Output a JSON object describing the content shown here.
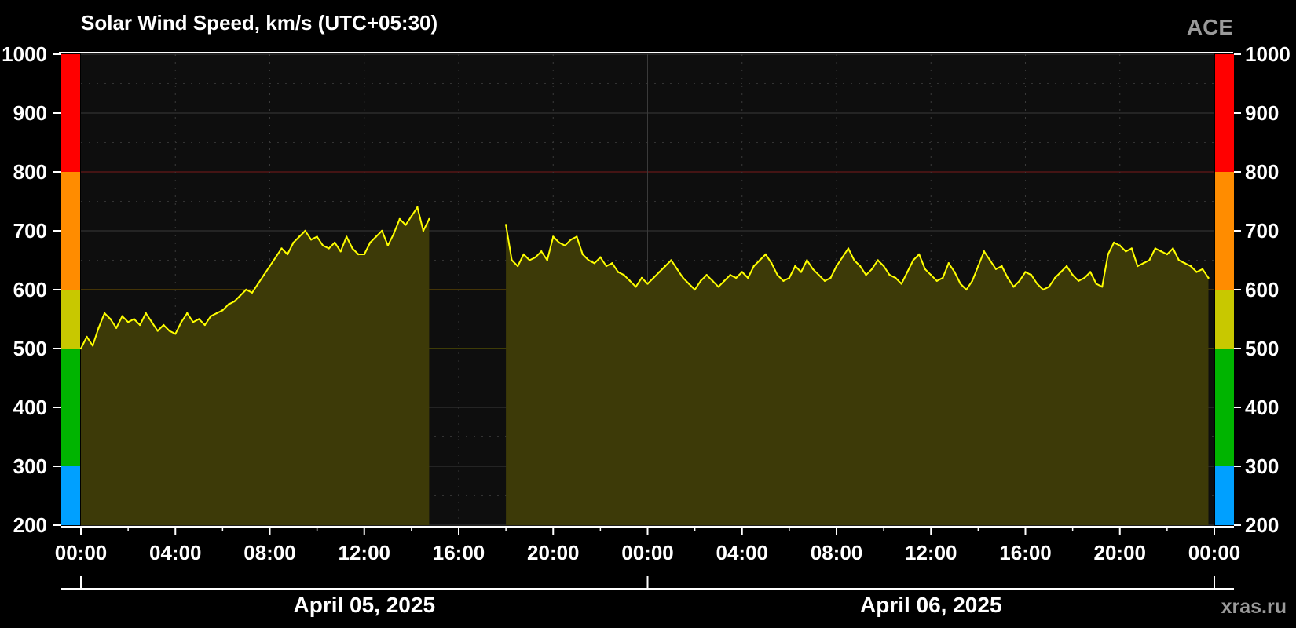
{
  "chart_data": {
    "type": "area",
    "title": "Solar Wind Speed, km/s (UTC+05:30)",
    "source_label": "ACE",
    "watermark": "xras.ru",
    "ylim": [
      200,
      1000
    ],
    "y_ticks": [
      "200",
      "300",
      "400",
      "500",
      "600",
      "700",
      "800",
      "900",
      "1000"
    ],
    "xlim_hours": [
      0,
      48
    ],
    "x_tick_labels": [
      "00:00",
      "04:00",
      "08:00",
      "12:00",
      "16:00",
      "20:00",
      "00:00",
      "04:00",
      "08:00",
      "12:00",
      "16:00",
      "20:00",
      "00:00"
    ],
    "dates": [
      "April 05, 2025",
      "April 06, 2025"
    ],
    "grid": true,
    "colors": {
      "line": "#ffff00",
      "fill": "#3d3a08",
      "plot_bg": "#0e0e0e",
      "band_quiet": "#00a0ff",
      "band_normal": "#00b400",
      "band_elevated": "#c8c800",
      "band_high": "#ff8c00",
      "band_extreme": "#ff0000"
    },
    "speed_bands": [
      {
        "from": 200,
        "to": 300,
        "color": "#00a0ff"
      },
      {
        "from": 300,
        "to": 500,
        "color": "#00b400"
      },
      {
        "from": 500,
        "to": 600,
        "color": "#c8c800"
      },
      {
        "from": 600,
        "to": 800,
        "color": "#ff8c00"
      },
      {
        "from": 800,
        "to": 1000,
        "color": "#ff0000"
      }
    ],
    "series": [
      {
        "x": [
          0.0,
          0.25,
          0.5,
          0.75,
          1.0,
          1.25,
          1.5,
          1.75,
          2.0,
          2.25,
          2.5,
          2.75,
          3.0,
          3.25,
          3.5,
          3.75,
          4.0,
          4.25,
          4.5,
          4.75,
          5.0,
          5.25,
          5.5,
          5.75,
          6.0,
          6.25,
          6.5,
          6.75,
          7.0,
          7.25,
          7.5,
          7.75,
          8.0,
          8.25,
          8.5,
          8.75,
          9.0,
          9.25,
          9.5,
          9.75,
          10.0,
          10.25,
          10.5,
          10.75,
          11.0,
          11.25,
          11.5,
          11.75,
          12.0,
          12.25,
          12.5,
          12.75,
          13.0,
          13.25,
          13.5,
          13.75,
          14.0,
          14.25,
          14.5,
          14.75
        ],
        "values": [
          500,
          520,
          505,
          535,
          560,
          550,
          535,
          555,
          545,
          550,
          540,
          560,
          545,
          530,
          540,
          530,
          525,
          545,
          560,
          545,
          550,
          540,
          555,
          560,
          565,
          575,
          580,
          590,
          600,
          595,
          610,
          625,
          640,
          655,
          670,
          660,
          680,
          690,
          700,
          685,
          690,
          675,
          670,
          680,
          665,
          690,
          670,
          660,
          660,
          680,
          690,
          700,
          675,
          695,
          720,
          710,
          725,
          740,
          700,
          720
        ]
      },
      {
        "x": [
          18.0,
          18.25,
          18.5,
          18.75,
          19.0,
          19.25,
          19.5,
          19.75,
          20.0,
          20.25,
          20.5,
          20.75,
          21.0,
          21.25,
          21.5,
          21.75,
          22.0,
          22.25,
          22.5,
          22.75,
          23.0,
          23.25,
          23.5,
          23.75,
          24.0,
          24.25,
          24.5,
          24.75,
          25.0,
          25.25,
          25.5,
          25.75,
          26.0,
          26.25,
          26.5,
          26.75,
          27.0,
          27.25,
          27.5,
          27.75,
          28.0,
          28.25,
          28.5,
          28.75,
          29.0,
          29.25,
          29.5,
          29.75,
          30.0,
          30.25,
          30.5,
          30.75,
          31.0,
          31.25,
          31.5,
          31.75,
          32.0,
          32.25,
          32.5,
          32.75,
          33.0,
          33.25,
          33.5,
          33.75,
          34.0,
          34.25,
          34.5,
          34.75,
          35.0,
          35.25,
          35.5,
          35.75,
          36.0,
          36.25,
          36.5,
          36.75,
          37.0,
          37.25,
          37.5,
          37.75,
          38.0,
          38.25,
          38.5,
          38.75,
          39.0,
          39.25,
          39.5,
          39.75,
          40.0,
          40.25,
          40.5,
          40.75,
          41.0,
          41.25,
          41.5,
          41.75,
          42.0,
          42.25,
          42.5,
          42.75,
          43.0,
          43.25,
          43.5,
          43.75,
          44.0,
          44.25,
          44.5,
          44.75,
          45.0,
          45.25,
          45.5,
          45.75,
          46.0,
          46.25,
          46.5,
          46.75,
          47.0,
          47.25,
          47.5,
          47.75
        ],
        "values": [
          710,
          650,
          640,
          660,
          650,
          655,
          665,
          650,
          690,
          680,
          675,
          685,
          690,
          660,
          650,
          645,
          655,
          640,
          645,
          630,
          625,
          615,
          605,
          620,
          610,
          620,
          630,
          640,
          650,
          635,
          620,
          610,
          600,
          615,
          625,
          615,
          605,
          615,
          625,
          620,
          630,
          620,
          640,
          650,
          660,
          645,
          625,
          615,
          620,
          640,
          630,
          650,
          635,
          625,
          615,
          620,
          640,
          655,
          670,
          650,
          640,
          625,
          635,
          650,
          640,
          625,
          620,
          610,
          630,
          650,
          660,
          635,
          625,
          615,
          620,
          645,
          630,
          610,
          600,
          615,
          640,
          665,
          650,
          635,
          640,
          620,
          605,
          615,
          630,
          625,
          610,
          600,
          605,
          620,
          630,
          640,
          625,
          615,
          620,
          630,
          610,
          605,
          660,
          680,
          675,
          665,
          670,
          640,
          645,
          650,
          670,
          665,
          660,
          670,
          650,
          645,
          640,
          630,
          635,
          620
        ]
      }
    ]
  }
}
